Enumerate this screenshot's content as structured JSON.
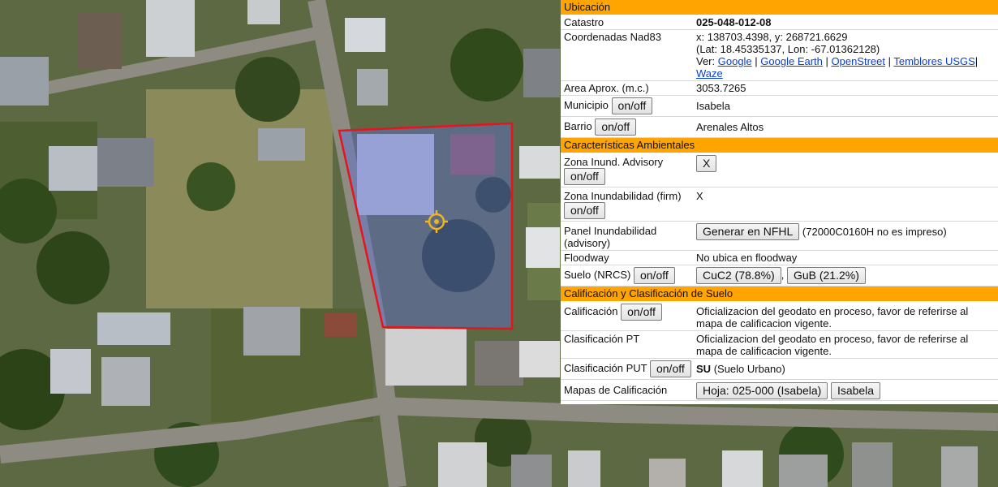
{
  "colors": {
    "section_bg": "#ffa400",
    "parcel_stroke": "#e8141c",
    "parcel_fill": "#5e6fd6",
    "link": "#0a3fd6"
  },
  "map": {
    "icons": [
      "location-target-icon"
    ]
  },
  "panel": {
    "ubicacion": {
      "header": "Ubicación",
      "catastro": {
        "label": "Catastro",
        "value": "025-048-012-08"
      },
      "coordenadas": {
        "label": "Coordenadas Nad83",
        "xy": "x: 138703.4398, y: 268721.6629",
        "latlon": "(Lat: 18.45335137, Lon: -67.01362128)",
        "ver": "Ver:",
        "links": {
          "google": "Google",
          "google_earth": "Google Earth",
          "openstreet": "OpenStreet",
          "temblores": "Temblores USGS",
          "waze": "Waze"
        }
      },
      "area": {
        "label": "Area Aprox. (m.c.)",
        "value": "3053.7265"
      },
      "municipio": {
        "label": "Municipio",
        "toggle": "on/off",
        "value": "Isabela"
      },
      "barrio": {
        "label": "Barrio",
        "toggle": "on/off",
        "value": "Arenales Altos"
      }
    },
    "ambientales": {
      "header": "Características Ambientales",
      "zona_advisory": {
        "label": "Zona Inund. Advisory",
        "toggle": "on/off",
        "value_button": "X"
      },
      "zona_firm": {
        "label": "Zona Inundabilidad (firm)",
        "toggle": "on/off",
        "value": "X"
      },
      "panel": {
        "label": "Panel Inundabilidad (advisory)",
        "button": "Generar en NFHL",
        "note": "(72000C0160H no es impreso)"
      },
      "floodway": {
        "label": "Floodway",
        "value": "No ubica en floodway"
      },
      "suelo": {
        "label": "Suelo (NRCS)",
        "toggle": "on/off",
        "soil1": "CuC2 (78.8%)",
        "soil2": "GuB (21.2%)"
      }
    },
    "calificacion": {
      "header": "Calificación y Clasificación de Suelo",
      "calif": {
        "label": "Calificación",
        "toggle": "on/off",
        "value": "Oficializacion del geodato en proceso, favor de referirse al mapa de calificacion vigente."
      },
      "pt": {
        "label": "Clasificación PT",
        "value": "Oficializacion del geodato en proceso, favor de referirse al mapa de calificacion vigente."
      },
      "put": {
        "label": "Clasificación PUT",
        "toggle": "on/off",
        "code": "SU",
        "desc": "(Suelo Urbano)"
      },
      "mapas": {
        "label": "Mapas de Calificación",
        "hoja": "Hoja: 025-000 (Isabela)",
        "isabela": "Isabela"
      }
    }
  }
}
